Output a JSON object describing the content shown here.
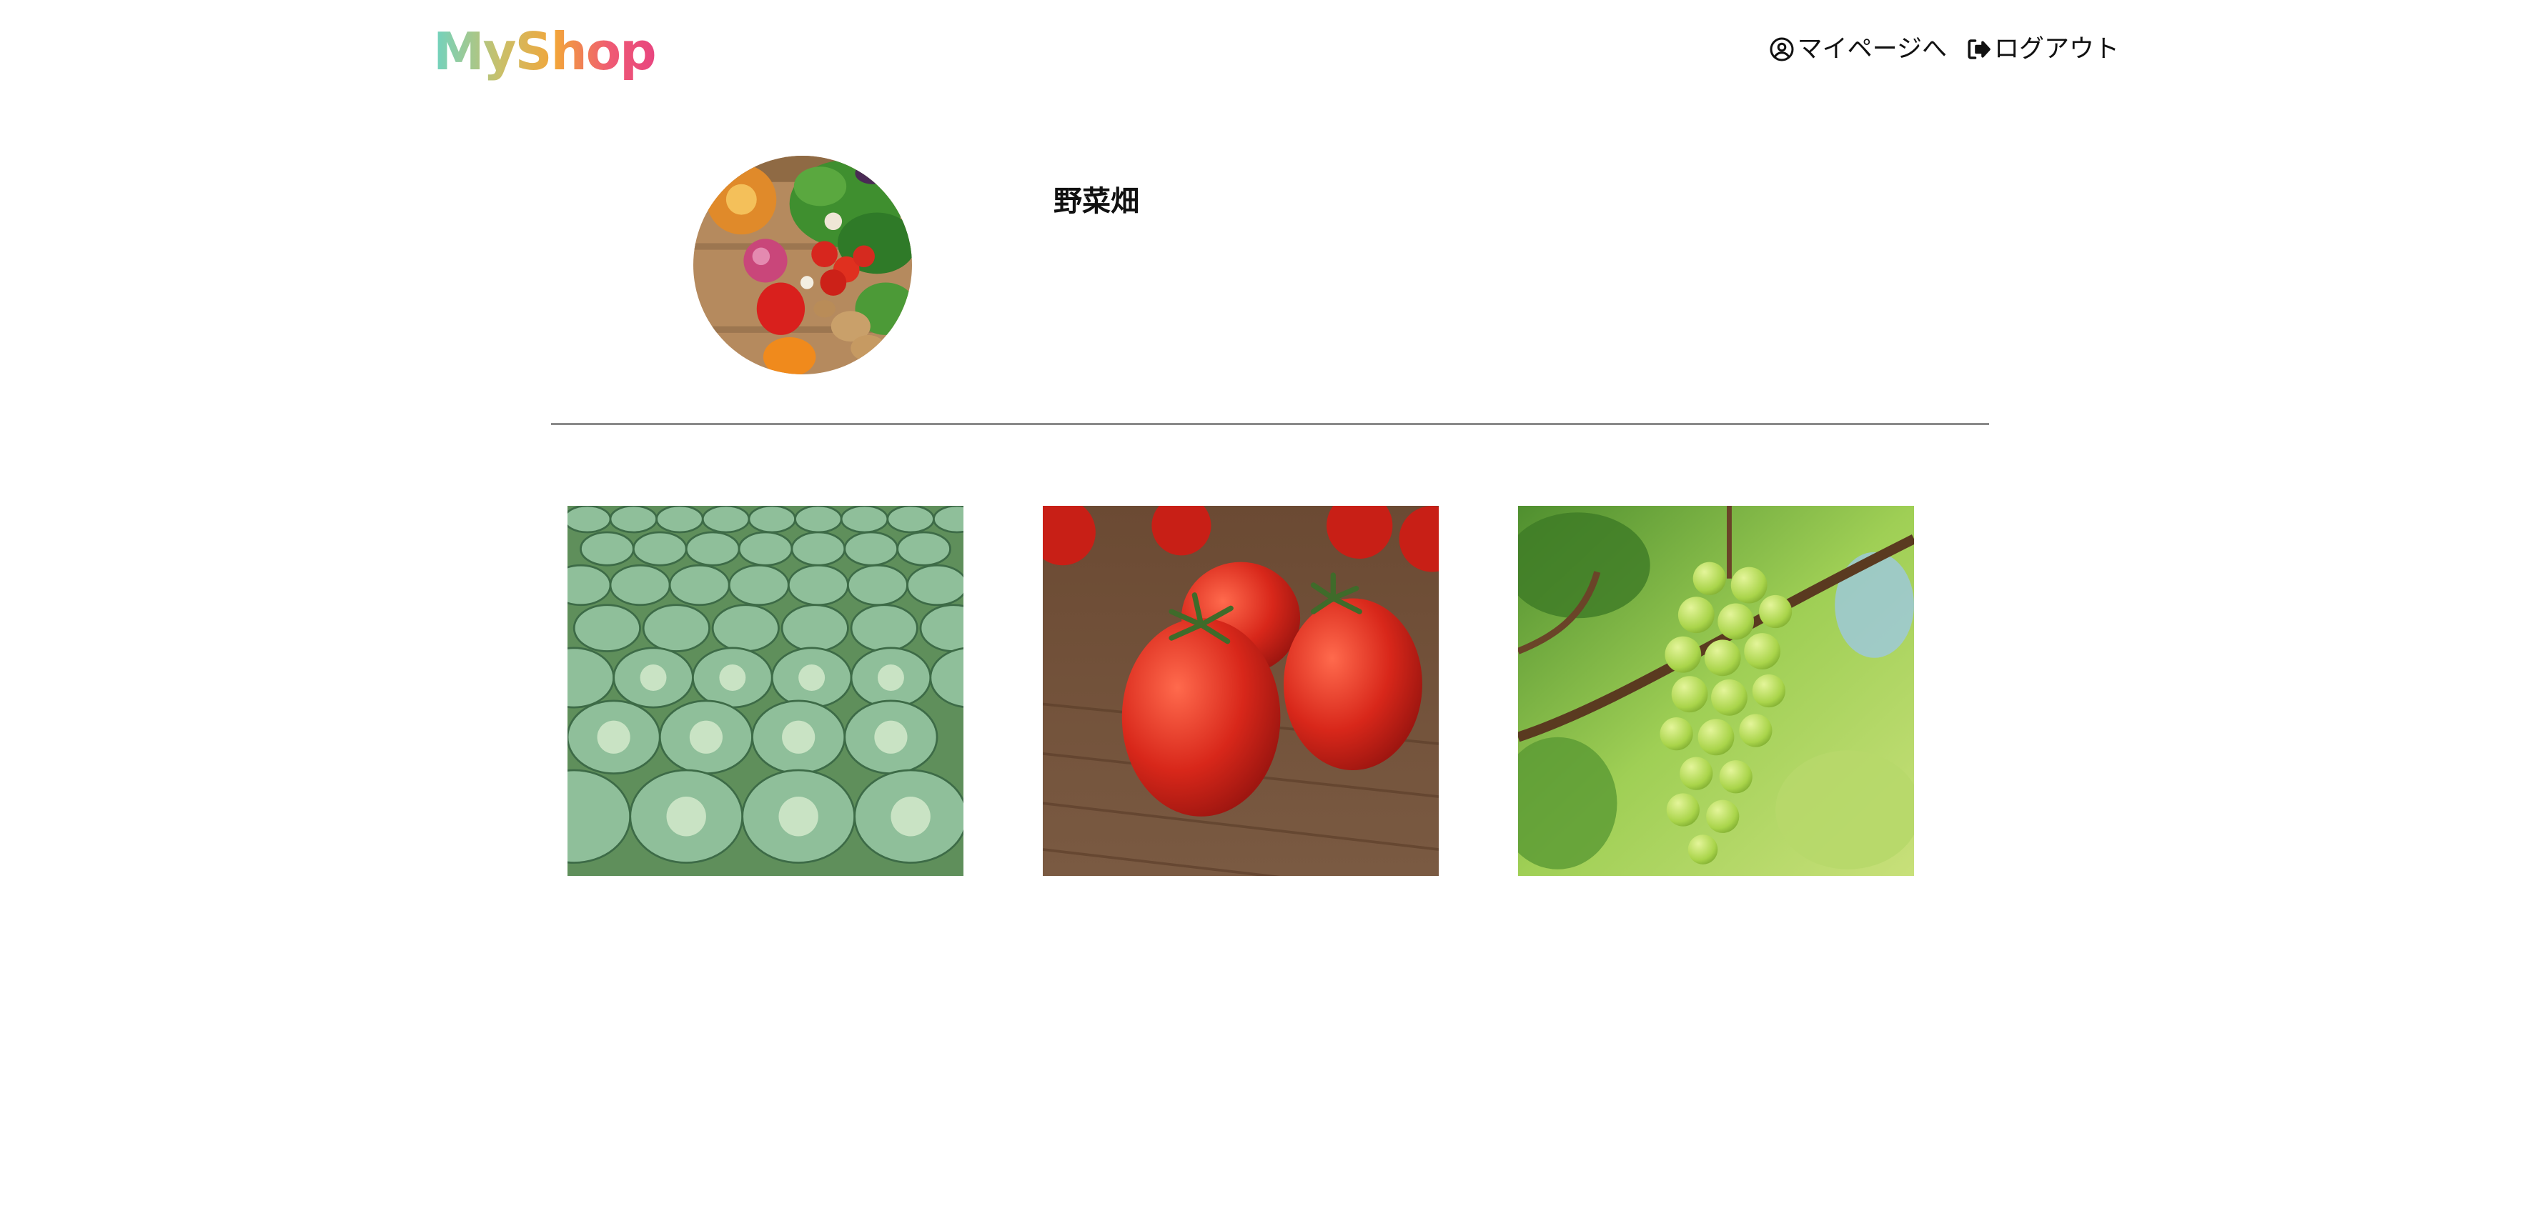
{
  "header": {
    "logo_text": "MyShop",
    "nav": {
      "mypage_label": "マイページへ",
      "logout_label": "ログアウト"
    }
  },
  "profile": {
    "shop_name": "野菜畑",
    "avatar_icon": "vegetables-photo"
  },
  "products": [
    {
      "image": "cabbage-field-photo"
    },
    {
      "image": "tomatoes-photo"
    },
    {
      "image": "green-grapes-photo"
    }
  ],
  "colors": {
    "logo_gradient": [
      "#6fd3c1",
      "#c9c06a",
      "#f2a53a",
      "#ef5a74",
      "#e8457f"
    ],
    "divider": "#8a8a8a"
  }
}
